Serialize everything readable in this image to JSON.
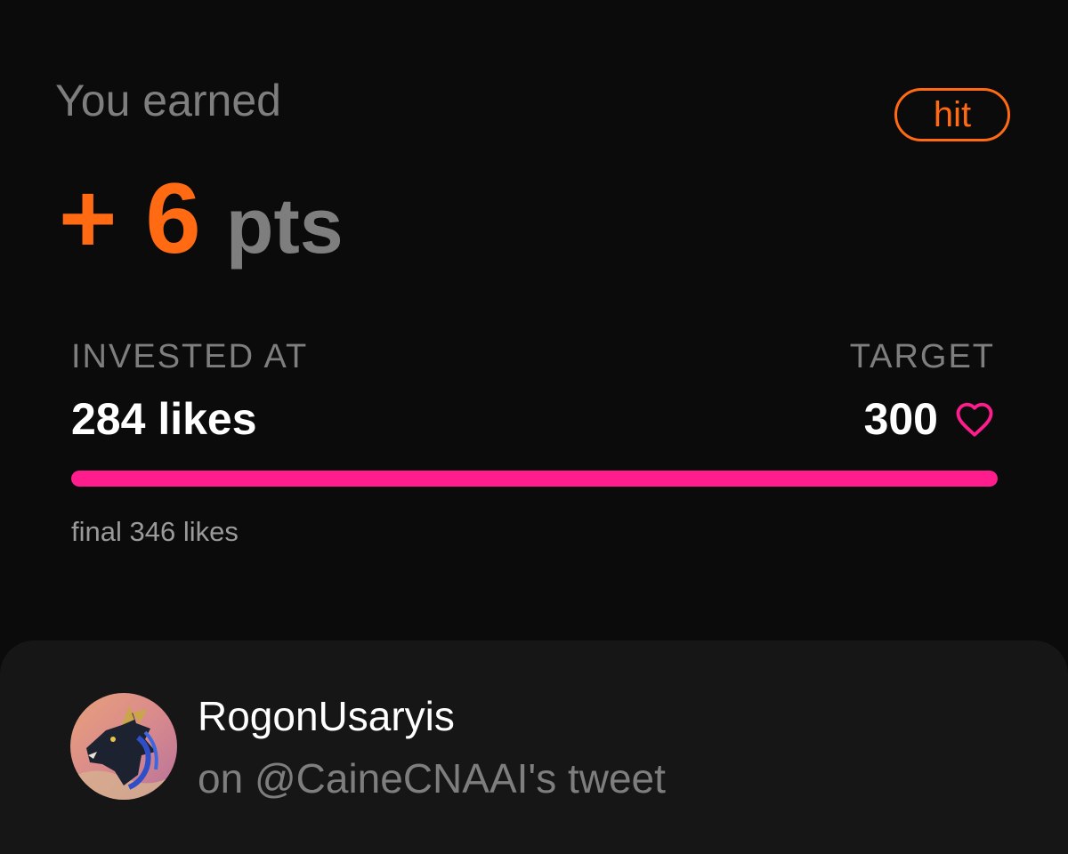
{
  "result": {
    "label": "You earned",
    "status": "hit",
    "points_sign": "+",
    "points_value": "6",
    "points_unit": "pts"
  },
  "investment": {
    "invested_label": "INVESTED AT",
    "invested_value": "284 likes",
    "target_label": "TARGET",
    "target_value": "300",
    "target_icon": "heart-outline-icon",
    "progress_fraction": 1.0,
    "final_text": "final 346 likes"
  },
  "tweet": {
    "username": "RogonUsaryis",
    "reference": "on @CaineCNAAI's tweet",
    "avatar_icon": "dragon-avatar"
  },
  "colors": {
    "background": "#0b0b0b",
    "card": "#161616",
    "accent_orange": "#ff6a13",
    "accent_pink": "#ff1d8e",
    "muted_text": "#7e7e7e",
    "primary_text": "#ffffff"
  }
}
